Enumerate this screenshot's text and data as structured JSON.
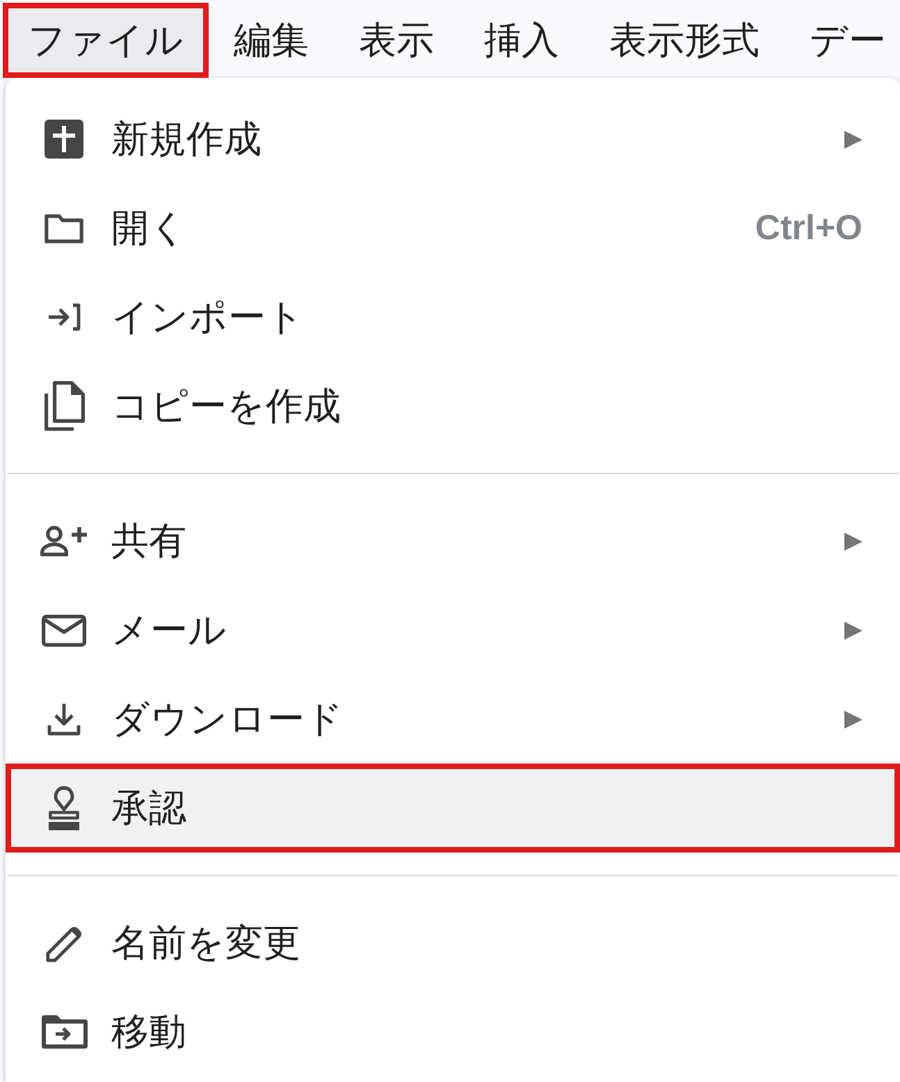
{
  "menu_bar": {
    "items": [
      {
        "label": "ファイル",
        "selected": true,
        "outlined": true
      },
      {
        "label": "編集",
        "selected": false,
        "outlined": false
      },
      {
        "label": "表示",
        "selected": false,
        "outlined": false
      },
      {
        "label": "挿入",
        "selected": false,
        "outlined": false
      },
      {
        "label": "表示形式",
        "selected": false,
        "outlined": false
      },
      {
        "label": "デー",
        "selected": false,
        "outlined": false
      }
    ]
  },
  "file_menu": {
    "sections": [
      {
        "items": [
          {
            "label": "新規作成",
            "submenu": true,
            "selected": false,
            "outlined": false
          },
          {
            "label": "開く",
            "shortcut": "Ctrl+O",
            "submenu": false,
            "selected": false,
            "outlined": false
          },
          {
            "label": "インポート",
            "submenu": false,
            "selected": false,
            "outlined": false
          },
          {
            "label": "コピーを作成",
            "submenu": false,
            "selected": false,
            "outlined": false
          }
        ]
      },
      {
        "items": [
          {
            "label": "共有",
            "submenu": true,
            "selected": false,
            "outlined": false
          },
          {
            "label": "メール",
            "submenu": true,
            "selected": false,
            "outlined": false
          },
          {
            "label": "ダウンロード",
            "submenu": true,
            "selected": false,
            "outlined": false
          },
          {
            "label": "承認",
            "submenu": false,
            "selected": true,
            "outlined": true
          }
        ]
      },
      {
        "items": [
          {
            "label": "名前を変更",
            "submenu": false,
            "selected": false,
            "outlined": false
          },
          {
            "label": "移動",
            "submenu": false,
            "selected": false,
            "outlined": false
          }
        ]
      }
    ]
  }
}
